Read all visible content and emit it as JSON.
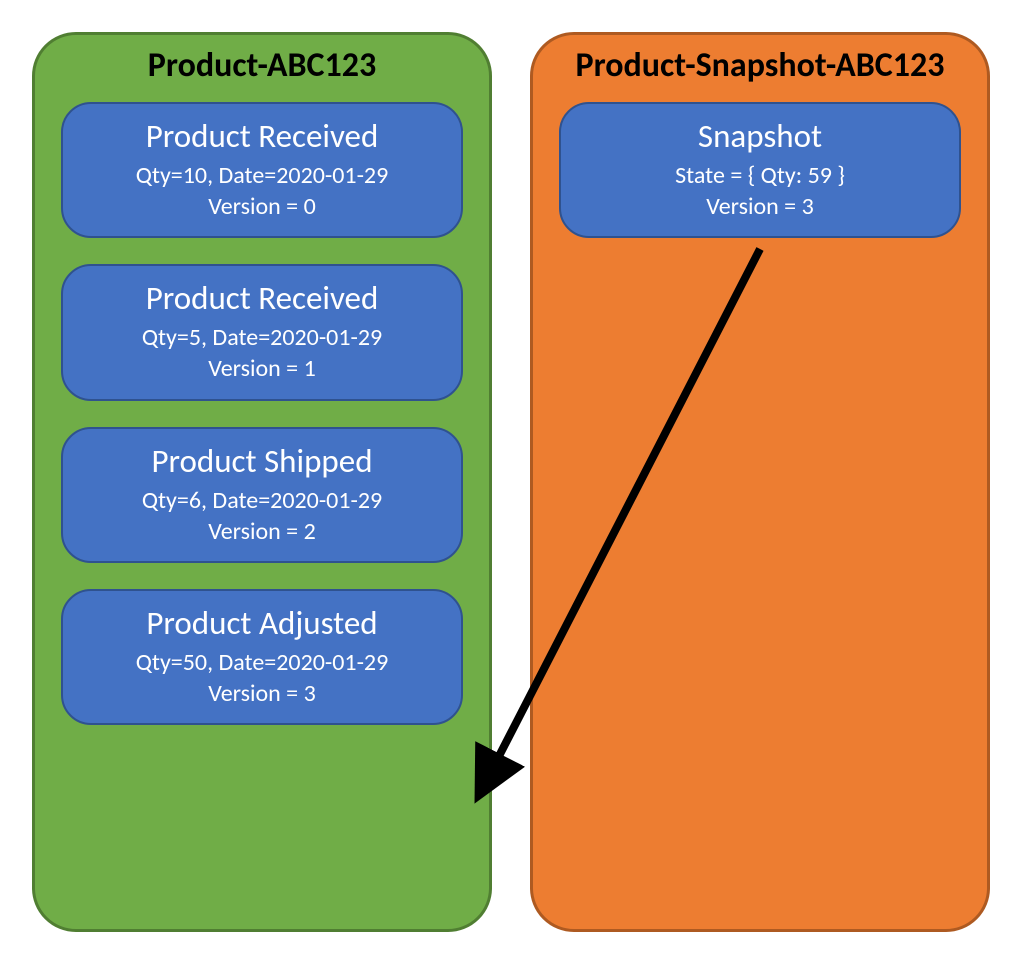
{
  "left": {
    "title": "Product-ABC123",
    "events": [
      {
        "title": "Product Received",
        "qty": "10",
        "date": "2020-01-29",
        "version": "0"
      },
      {
        "title": "Product Received",
        "qty": "5",
        "date": "2020-01-29",
        "version": "1"
      },
      {
        "title": "Product Shipped",
        "qty": "6",
        "date": "2020-01-29",
        "version": "2"
      },
      {
        "title": "Product Adjusted",
        "qty": "50",
        "date": "2020-01-29",
        "version": "3"
      }
    ]
  },
  "right": {
    "title": "Product-Snapshot-ABC123",
    "snapshot": {
      "title": "Snapshot",
      "state_label": "State = { Qty: 59 }",
      "version": "3"
    }
  },
  "labels": {
    "qty_prefix": "Qty=",
    "date_prefix": ", Date=",
    "version_prefix": "Version = "
  }
}
